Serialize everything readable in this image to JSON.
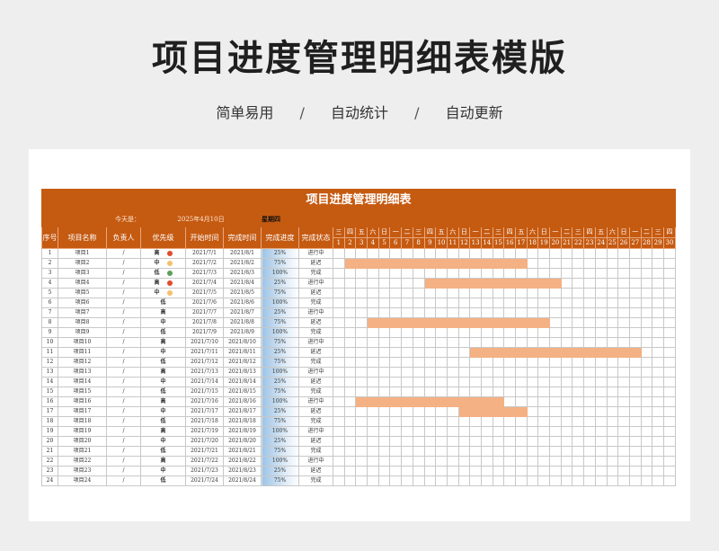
{
  "hero": {
    "title": "项目进度管理明细表模版",
    "tags": [
      "简单易用",
      "自动统计",
      "自动更新"
    ],
    "separator": "/"
  },
  "sheet": {
    "title": "项目进度管理明细表",
    "today_label": "今天是：",
    "today_value": "2025年4月10日",
    "weekday": "星期四",
    "headers": [
      "序号",
      "项目名称",
      "负责人",
      "优先级",
      "开始时间",
      "完成时间",
      "完成进度",
      "完成状态"
    ],
    "weekdays": [
      "三",
      "四",
      "五",
      "六",
      "日",
      "一",
      "二",
      "三",
      "四",
      "五",
      "六",
      "日",
      "一",
      "二",
      "三",
      "四",
      "五",
      "六",
      "日",
      "一",
      "二",
      "三",
      "四",
      "五",
      "六",
      "日",
      "一",
      "二",
      "三",
      "四"
    ],
    "days": [
      "1",
      "2",
      "3",
      "4",
      "5",
      "6",
      "7",
      "8",
      "9",
      "10",
      "11",
      "12",
      "13",
      "14",
      "15",
      "16",
      "17",
      "18",
      "19",
      "20",
      "21",
      "22",
      "23",
      "24",
      "25",
      "26",
      "27",
      "28",
      "29",
      "30"
    ],
    "colors": {
      "header_bg": "#c55a11",
      "bar": "#f4b183",
      "high": "#e04b2a",
      "mid": "#f4c06f",
      "low": "#5aa05a"
    },
    "rows": [
      {
        "no": "1",
        "name": "项目1",
        "owner": "/",
        "priority": "高",
        "dot": "high",
        "start": "2021/7/1",
        "end": "2021/8/1",
        "progress": "25%",
        "status": "进行中"
      },
      {
        "no": "2",
        "name": "项目2",
        "owner": "/",
        "priority": "中",
        "dot": "mid",
        "start": "2021/7/2",
        "end": "2021/8/2",
        "progress": "75%",
        "status": "延迟",
        "bar": [
          1,
          16
        ]
      },
      {
        "no": "3",
        "name": "项目3",
        "owner": "/",
        "priority": "低",
        "dot": "low",
        "start": "2021/7/3",
        "end": "2021/8/3",
        "progress": "100%",
        "status": "完成"
      },
      {
        "no": "4",
        "name": "项目4",
        "owner": "/",
        "priority": "高",
        "dot": "high",
        "start": "2021/7/4",
        "end": "2021/8/4",
        "progress": "25%",
        "status": "进行中",
        "bar": [
          8,
          19
        ]
      },
      {
        "no": "5",
        "name": "项目5",
        "owner": "/",
        "priority": "中",
        "dot": "mid",
        "start": "2021/7/5",
        "end": "2021/8/5",
        "progress": "75%",
        "status": "延迟"
      },
      {
        "no": "6",
        "name": "项目6",
        "owner": "/",
        "priority": "低",
        "start": "2021/7/6",
        "end": "2021/8/6",
        "progress": "100%",
        "status": "完成"
      },
      {
        "no": "7",
        "name": "项目7",
        "owner": "/",
        "priority": "高",
        "start": "2021/7/7",
        "end": "2021/8/7",
        "progress": "25%",
        "status": "进行中"
      },
      {
        "no": "8",
        "name": "项目8",
        "owner": "/",
        "priority": "中",
        "start": "2021/7/8",
        "end": "2021/8/8",
        "progress": "75%",
        "status": "延迟",
        "bar": [
          3,
          18
        ]
      },
      {
        "no": "9",
        "name": "项目9",
        "owner": "/",
        "priority": "低",
        "start": "2021/7/9",
        "end": "2021/8/9",
        "progress": "100%",
        "status": "完成"
      },
      {
        "no": "10",
        "name": "项目10",
        "owner": "/",
        "priority": "高",
        "start": "2021/7/10",
        "end": "2021/8/10",
        "progress": "75%",
        "status": "进行中"
      },
      {
        "no": "11",
        "name": "项目11",
        "owner": "/",
        "priority": "中",
        "start": "2021/7/11",
        "end": "2021/8/11",
        "progress": "25%",
        "status": "延迟",
        "bar": [
          12,
          26
        ]
      },
      {
        "no": "12",
        "name": "项目12",
        "owner": "/",
        "priority": "低",
        "start": "2021/7/12",
        "end": "2021/8/12",
        "progress": "75%",
        "status": "完成"
      },
      {
        "no": "13",
        "name": "项目13",
        "owner": "/",
        "priority": "高",
        "start": "2021/7/13",
        "end": "2021/8/13",
        "progress": "100%",
        "status": "进行中"
      },
      {
        "no": "14",
        "name": "项目14",
        "owner": "/",
        "priority": "中",
        "start": "2021/7/14",
        "end": "2021/8/14",
        "progress": "25%",
        "status": "延迟"
      },
      {
        "no": "15",
        "name": "项目15",
        "owner": "/",
        "priority": "低",
        "start": "2021/7/15",
        "end": "2021/8/15",
        "progress": "75%",
        "status": "完成"
      },
      {
        "no": "16",
        "name": "项目16",
        "owner": "/",
        "priority": "高",
        "start": "2021/7/16",
        "end": "2021/8/16",
        "progress": "100%",
        "status": "进行中",
        "bar": [
          2,
          14
        ]
      },
      {
        "no": "17",
        "name": "项目17",
        "owner": "/",
        "priority": "中",
        "start": "2021/7/17",
        "end": "2021/8/17",
        "progress": "25%",
        "status": "延迟",
        "bar": [
          11,
          16
        ]
      },
      {
        "no": "18",
        "name": "项目18",
        "owner": "/",
        "priority": "低",
        "start": "2021/7/18",
        "end": "2021/8/18",
        "progress": "75%",
        "status": "完成"
      },
      {
        "no": "19",
        "name": "项目19",
        "owner": "/",
        "priority": "高",
        "start": "2021/7/19",
        "end": "2021/8/19",
        "progress": "100%",
        "status": "进行中"
      },
      {
        "no": "20",
        "name": "项目20",
        "owner": "/",
        "priority": "中",
        "start": "2021/7/20",
        "end": "2021/8/20",
        "progress": "25%",
        "status": "延迟"
      },
      {
        "no": "21",
        "name": "项目21",
        "owner": "/",
        "priority": "低",
        "start": "2021/7/21",
        "end": "2021/8/21",
        "progress": "75%",
        "status": "完成"
      },
      {
        "no": "22",
        "name": "项目22",
        "owner": "/",
        "priority": "高",
        "start": "2021/7/22",
        "end": "2021/8/22",
        "progress": "100%",
        "status": "进行中"
      },
      {
        "no": "23",
        "name": "项目23",
        "owner": "/",
        "priority": "中",
        "start": "2021/7/23",
        "end": "2021/8/23",
        "progress": "25%",
        "status": "延迟"
      },
      {
        "no": "24",
        "name": "项目24",
        "owner": "/",
        "priority": "低",
        "start": "2021/7/24",
        "end": "2021/8/24",
        "progress": "75%",
        "status": "完成"
      }
    ]
  }
}
